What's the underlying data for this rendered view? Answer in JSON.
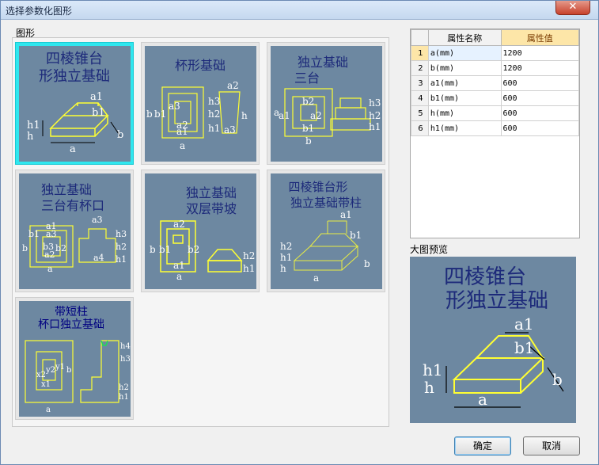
{
  "window": {
    "title": "选择参数化图形",
    "close_label": "✕"
  },
  "gallery": {
    "label": "图形",
    "items": [
      {
        "title": "四棱锥台形独立基础",
        "selected": true
      },
      {
        "title": "杯形基础",
        "selected": false
      },
      {
        "title": "独立基础三台",
        "selected": false
      },
      {
        "title": "独立基础三台有杯口",
        "selected": false
      },
      {
        "title": "独立基础双层带坡",
        "selected": false
      },
      {
        "title": "四棱锥台形独立基础带柱",
        "selected": false
      },
      {
        "title": "带短柱杯口独立基础",
        "selected": false
      }
    ]
  },
  "properties": {
    "header_name": "属性名称",
    "header_value": "属性值",
    "rows": [
      {
        "index": "1",
        "name": "a(mm)",
        "value": "1200"
      },
      {
        "index": "2",
        "name": "b(mm)",
        "value": "1200"
      },
      {
        "index": "3",
        "name": "a1(mm)",
        "value": "600"
      },
      {
        "index": "4",
        "name": "b1(mm)",
        "value": "600"
      },
      {
        "index": "5",
        "name": "h(mm)",
        "value": "600"
      },
      {
        "index": "6",
        "name": "h1(mm)",
        "value": "600"
      }
    ]
  },
  "preview": {
    "label": "大图预览",
    "title_line1": "四棱锥台",
    "title_line2": "形独立基础"
  },
  "buttons": {
    "ok": "确定",
    "cancel": "取消"
  },
  "colors": {
    "thumb_bg": "#6d88a1",
    "drawing": "#ffff33",
    "selection": "#2fe7ef",
    "title_text": "#1d2a7a"
  }
}
